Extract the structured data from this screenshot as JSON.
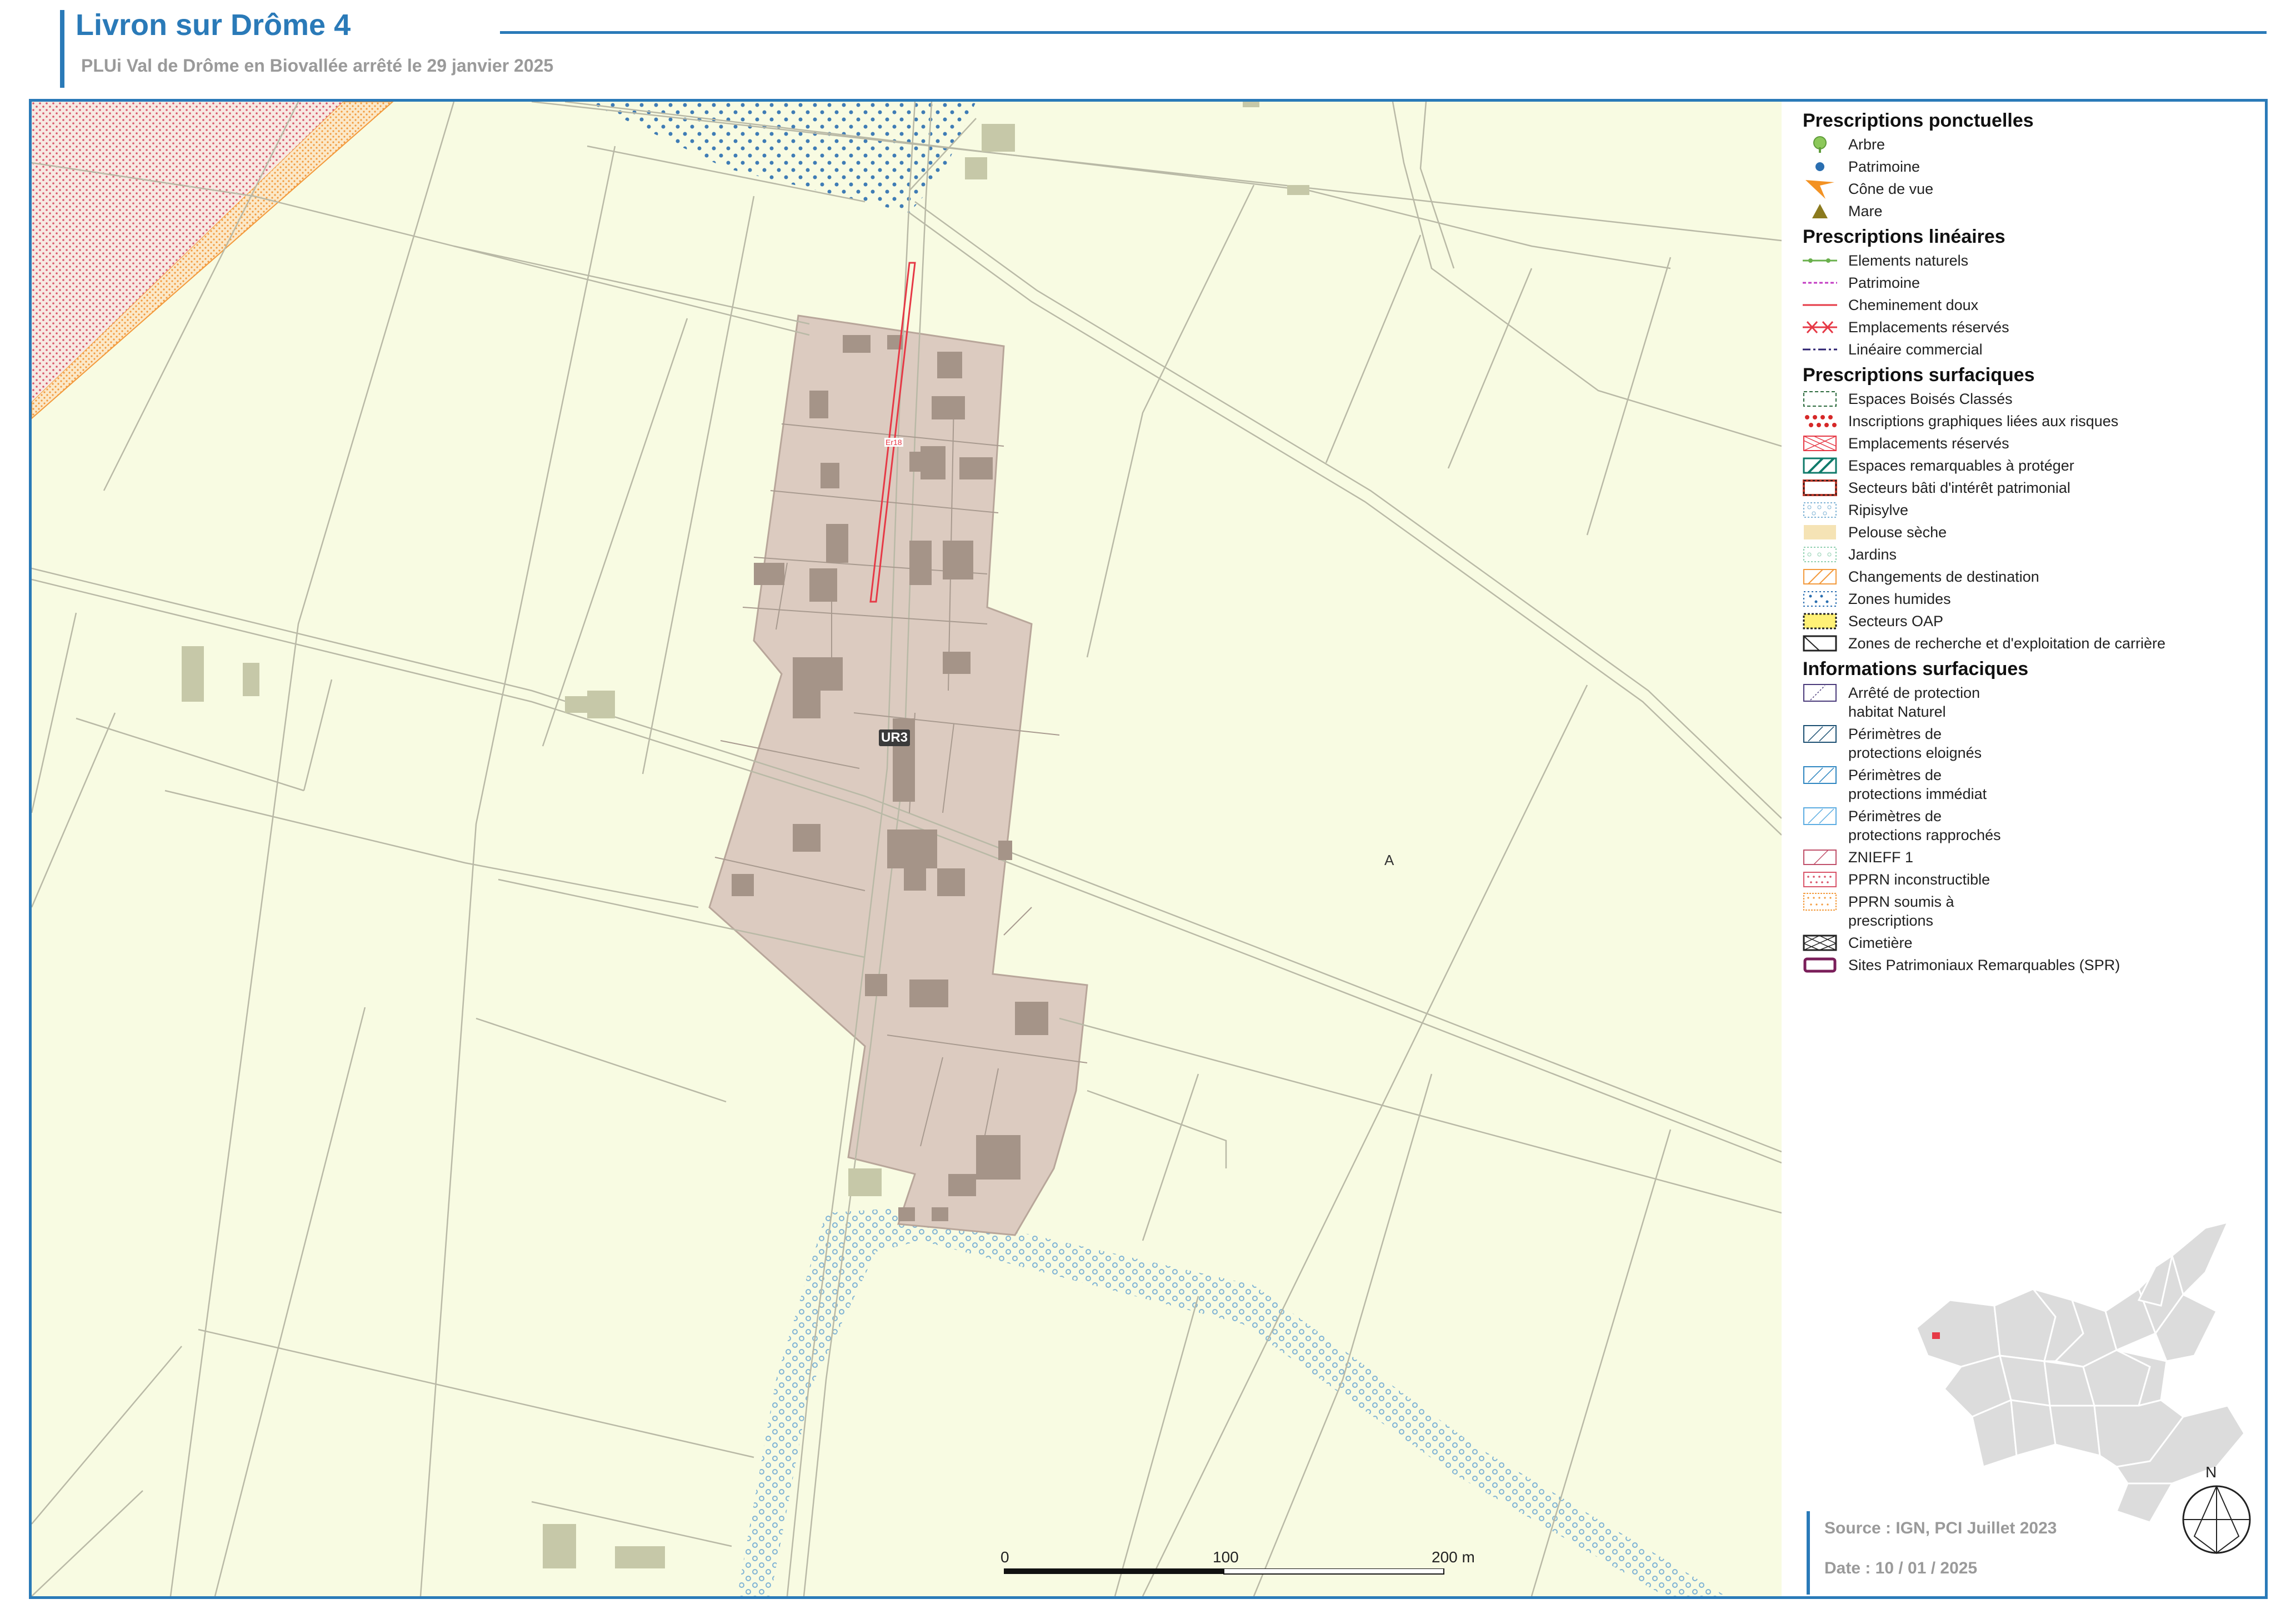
{
  "header": {
    "title": "Livron sur Drôme 4",
    "subtitle": "PLUi Val de Drôme en Biovallée arrêté le 29 janvier 2025"
  },
  "map": {
    "zone_labels": {
      "ur3": "UR3",
      "a": "A",
      "er": "Er18"
    },
    "scale": {
      "t0": "0",
      "t1": "100",
      "t2": "200 m"
    }
  },
  "legend": {
    "ponctuelles": {
      "title": "Prescriptions ponctuelles",
      "items": [
        {
          "label": "Arbre",
          "icon": "tree-icon",
          "color": "#8cc85a"
        },
        {
          "label": "Patrimoine",
          "icon": "dot-icon",
          "color": "#2a6eb0"
        },
        {
          "label": "Cône de vue",
          "icon": "view-cone-icon",
          "color": "#f39223"
        },
        {
          "label": "Mare",
          "icon": "triangle-icon",
          "color": "#8b7a1e"
        }
      ]
    },
    "lineaires": {
      "title": "Prescriptions linéaires",
      "items": [
        {
          "label": "Elements naturels",
          "color": "#6ab04c"
        },
        {
          "label": "Patrimoine",
          "color": "#c23bc2"
        },
        {
          "label": "Cheminement doux",
          "color": "#e63946"
        },
        {
          "label": "Emplacements réservés",
          "color": "#e63946"
        },
        {
          "label": "Linéaire commercial",
          "color": "#2c2170"
        }
      ]
    },
    "surfaciques": {
      "title": "Prescriptions surfaciques",
      "items": [
        {
          "label": "Espaces Boisés Classés"
        },
        {
          "label": "Inscriptions graphiques liées aux risques"
        },
        {
          "label": "Emplacements réservés"
        },
        {
          "label": "Espaces remarquables à protéger"
        },
        {
          "label": "Secteurs bâti d'intérêt patrimonial"
        },
        {
          "label": "Ripisylve"
        },
        {
          "label": "Pelouse sèche"
        },
        {
          "label": "Jardins"
        },
        {
          "label": "Changements de destination"
        },
        {
          "label": "Zones humides"
        },
        {
          "label": "Secteurs OAP"
        },
        {
          "label": "Zones de recherche et d'exploitation de carrière"
        }
      ]
    },
    "informations": {
      "title": "Informations surfaciques",
      "items": [
        {
          "l1": "Arrêté de protection",
          "l2": "habitat Naturel"
        },
        {
          "l1": "Périmètres de",
          "l2": "protections eloignés"
        },
        {
          "l1": "Périmètres de",
          "l2": "protections immédiat"
        },
        {
          "l1": "Périmètres de",
          "l2": "protections rapprochés"
        },
        {
          "l1": "ZNIEFF 1",
          "l2": ""
        },
        {
          "l1": "PPRN inconstructible",
          "l2": ""
        },
        {
          "l1": "PPRN soumis à",
          "l2": "prescriptions"
        },
        {
          "l1": "Cimetière",
          "l2": ""
        },
        {
          "l1": "Sites Patrimoniaux Remarquables (SPR)",
          "l2": ""
        }
      ]
    }
  },
  "footer": {
    "source": "Source : IGN, PCI Juillet 2023",
    "date": "Date : 10 / 01 / 2025",
    "north": "N"
  }
}
